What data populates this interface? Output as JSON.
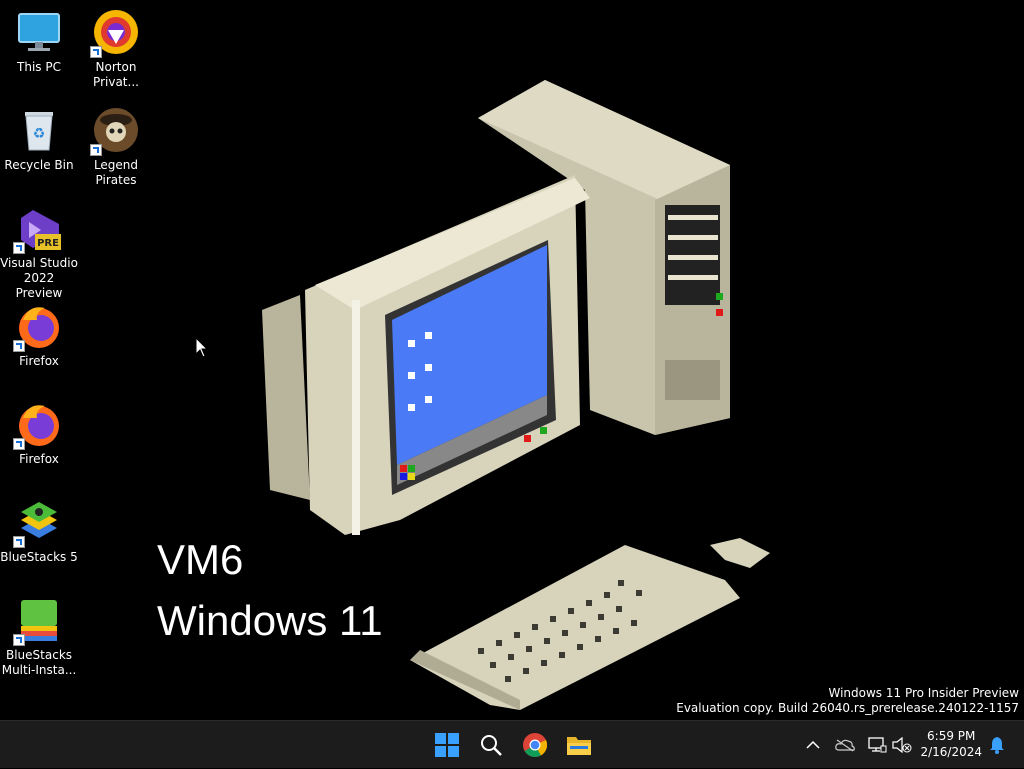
{
  "desktop": {
    "icons": [
      {
        "label": "This PC",
        "icon": "monitor-icon"
      },
      {
        "label": "Norton Privat...",
        "icon": "norton-icon"
      },
      {
        "label": "Recycle Bin",
        "icon": "recycle-bin-icon"
      },
      {
        "label": "Legend Pirates",
        "icon": "pirate-skull-icon"
      },
      {
        "label": "Visual Studio 2022 Preview",
        "icon": "visual-studio-icon",
        "badge": "PRE"
      },
      {
        "label": "Firefox",
        "icon": "firefox-icon"
      },
      {
        "label": "Firefox",
        "icon": "firefox-icon"
      },
      {
        "label": "BlueStacks 5",
        "icon": "bluestacks-icon"
      },
      {
        "label": "BlueStacks Multi-Insta...",
        "icon": "bluestacks-multi-icon"
      }
    ]
  },
  "wallpaper": {
    "line1": "VM6",
    "line2": "Windows 11",
    "screen_color": "#4a7af5",
    "case_color": "#d8d4bc"
  },
  "watermark": {
    "line1": "Windows 11 Pro Insider Preview",
    "line2": "Evaluation copy. Build 26040.rs_prerelease.240122-1157"
  },
  "taskbar": {
    "pinned": [
      "start-icon",
      "search-icon",
      "chrome-icon",
      "file-explorer-icon"
    ],
    "tray": [
      "chevron-up-icon",
      "onedrive-icon",
      "network-icon",
      "volume-muted-icon",
      "notification-bell-icon"
    ],
    "time": "6:59 PM",
    "date": "2/16/2024"
  },
  "colors": {
    "taskbar_bg": "#1c1c1c",
    "accent": "#0078d4"
  }
}
